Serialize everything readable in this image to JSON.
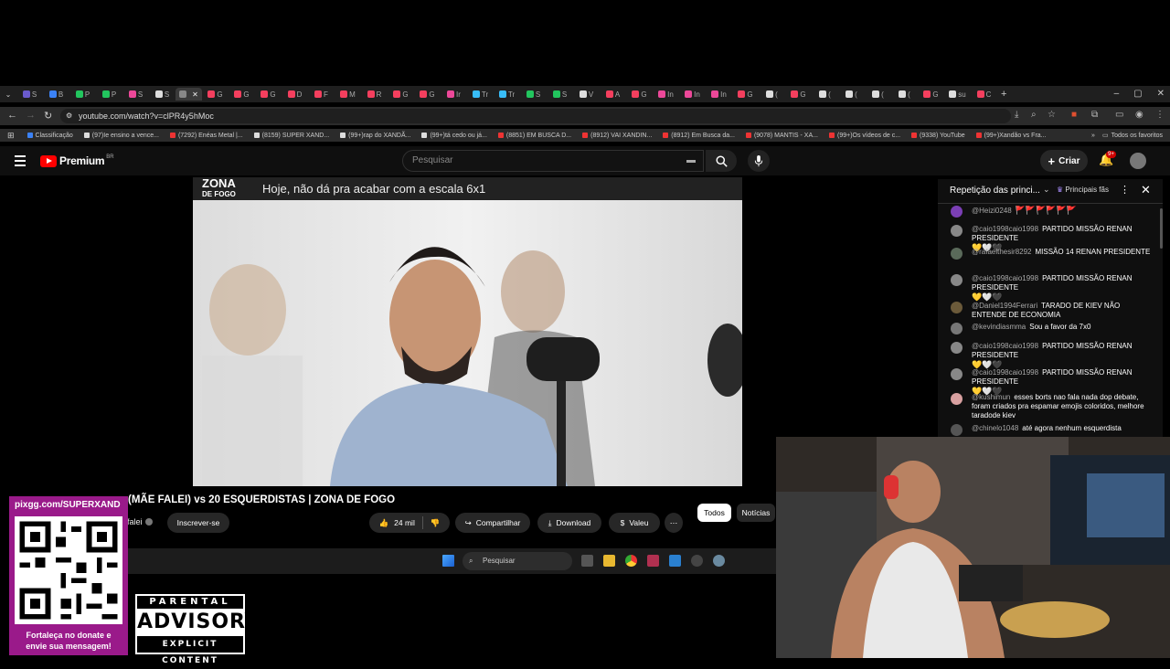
{
  "browser": {
    "tabs": [
      "S",
      "B",
      "P",
      "P",
      "S",
      "S",
      "",
      "G",
      "G",
      "G",
      "D",
      "F",
      "M",
      "R",
      "G",
      "G",
      "Ir",
      "Tr",
      "Tr",
      "S",
      "S",
      "V",
      "A",
      "G",
      "In",
      "In",
      "In",
      "G",
      "(",
      "G",
      "(",
      "(",
      "(",
      "(",
      "G",
      "su",
      "C"
    ],
    "active_tab_index": 6,
    "url": "youtube.com/watch?v=clPR4y5hMoc",
    "bookmarks": [
      "Classificação",
      "(97)Ie ensino a vence...",
      "(7292) Enéas Metal |...",
      "(8159) SUPER XAND...",
      "(99+)rap do XANDÃ...",
      "(99+)tá cedo ou já...",
      "(8851) EM BUSCA D...",
      "(8912) VAI XANDIN...",
      "(8912) Em Busca da...",
      "(9078) MANTIS - XA...",
      "(99+)Os vídeos de c...",
      "(9338) YouTube",
      "(99+)Xandão vs Fra..."
    ],
    "all_favorites": "Todos os favoritos"
  },
  "youtube": {
    "logo_text": "Premium",
    "logo_region": "BR",
    "search_placeholder": "Pesquisar",
    "create_label": "Criar",
    "notif_count": "9+"
  },
  "video": {
    "banner_brand_top": "ZONA",
    "banner_brand_bottom": "DE FOGO",
    "banner_headline": "Hoje, não dá pra acabar com a escala 6x1",
    "title": "(MÃE FALEI) vs 20 ESQUERDISTAS | ZONA DE FOGO",
    "channel": "falei",
    "subscribe_label": "Inscrever-se",
    "likes": "24 mil",
    "share_label": "Compartilhar",
    "download_label": "Download",
    "thanks_label": "Valeu",
    "chip_all": "Todos",
    "chip_news": "Notícias"
  },
  "chat": {
    "header": "Repetição das princi...",
    "badge": "Principais fãs",
    "messages": [
      {
        "author": "@Heizi0248",
        "text": "",
        "emoji": "🚩🚩🚩🚩🚩🚩",
        "color": "#7b3fb5"
      },
      {
        "author": "@caio1998caio1998",
        "text": "PARTIDO MISSÃO RENAN PRESIDENTE",
        "emoji": "💛🤍🖤",
        "color": "#888888"
      },
      {
        "author": "@rafaelthesir8292",
        "text": "MISSÃO 14 RENAN PRESIDENTE",
        "emoji": "",
        "color": "#5a6a5a"
      },
      {
        "author": "@caio1998caio1998",
        "text": "PARTIDO MISSÃO RENAN PRESIDENTE",
        "emoji": "💛🤍🖤",
        "color": "#888888"
      },
      {
        "author": "@Daniel1994Ferrari",
        "text": "TARADO DE KIEV NÃO ENTENDE DE ECONOMIA",
        "emoji": "",
        "color": "#6b5a3a"
      },
      {
        "author": "@kevindiasmma",
        "text": "Sou a favor da 7x0",
        "emoji": "",
        "color": "#777777"
      },
      {
        "author": "@caio1998caio1998",
        "text": "PARTIDO MISSÃO RENAN PRESIDENTE",
        "emoji": "💛🤍🖤",
        "color": "#888888"
      },
      {
        "author": "@caio1998caio1998",
        "text": "PARTIDO MISSÃO RENAN PRESIDENTE",
        "emoji": "💛🤍🖤",
        "color": "#888888"
      },
      {
        "author": "@kushimun",
        "text": "esses borts nao fala nada dop debate, foram criados pra espamar emojis coloridos, melhore taradode kiev",
        "emoji": "",
        "color": "#d8a0a0"
      },
      {
        "author": "@chinelo1048",
        "text": "até agora nenhum esquerdista",
        "emoji": "",
        "color": "#555555"
      }
    ]
  },
  "taskbar": {
    "search_placeholder": "Pesquisar"
  },
  "overlay": {
    "qr_link": "pixgg.com/SUPERXAND",
    "qr_message_line1": "Fortaleça no donate e",
    "qr_message_line2": "envie sua mensagem!",
    "pa_line1": "PARENTAL",
    "pa_line2": "ADVISORY",
    "pa_line3": "EXPLICIT CONTENT"
  }
}
